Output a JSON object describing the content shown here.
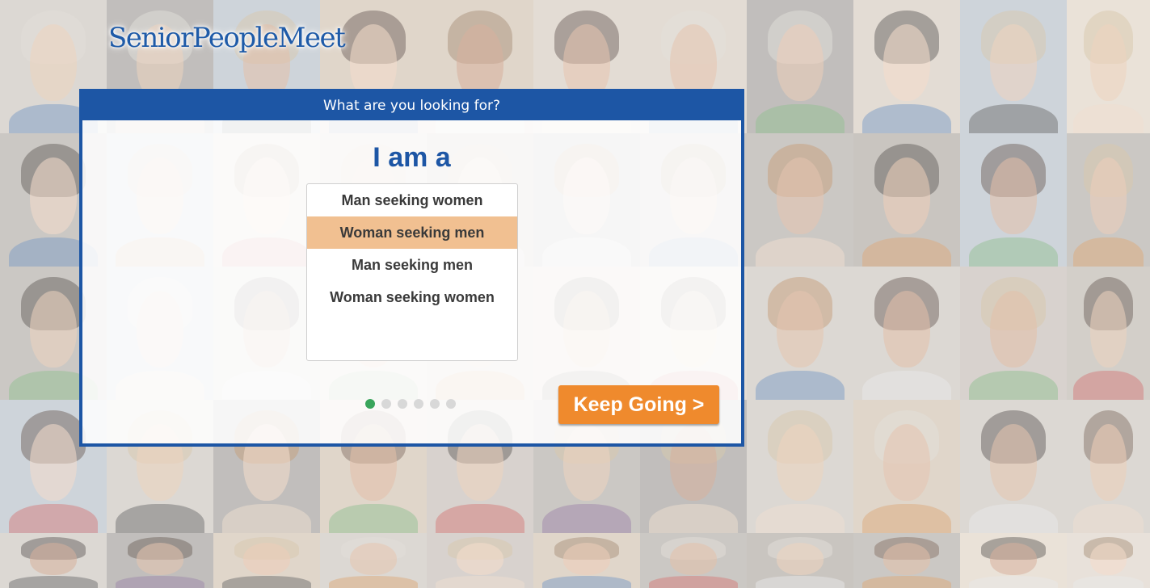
{
  "brand": {
    "logo_text": "SeniorPeopleMeet",
    "color": "#1f5ba8"
  },
  "modal": {
    "header": "What are you looking for?",
    "title": "I am a",
    "options": [
      "Man seeking women",
      "Woman seeking men",
      "Man seeking men",
      "Woman seeking women"
    ],
    "selected_option": "Woman seeking men",
    "steps_total": 6,
    "current_step": 1,
    "continue_label": "Keep Going >"
  },
  "colors": {
    "primary": "#1d56a5",
    "cta": "#ef8a2d",
    "selected": "#f1c091",
    "progress_active": "#3aa55c"
  }
}
